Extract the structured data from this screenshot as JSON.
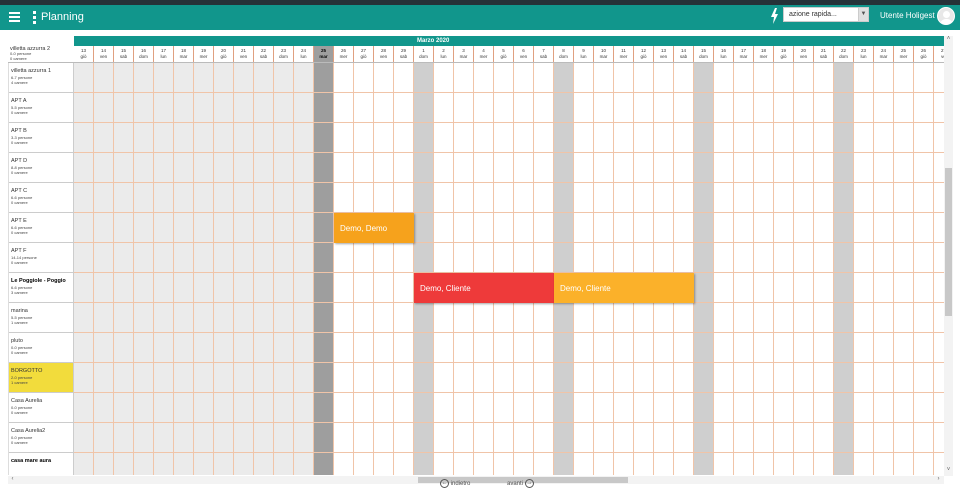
{
  "app": {
    "title": "Planning"
  },
  "header": {
    "quick_action_placeholder": "azione rapida...",
    "user_name": "Utente Holigest"
  },
  "calendar": {
    "month_label": "Marzo 2020",
    "today_index": 12,
    "days": [
      {
        "num": "13",
        "dow": "giò"
      },
      {
        "num": "14",
        "dow": "ven"
      },
      {
        "num": "15",
        "dow": "sab"
      },
      {
        "num": "16",
        "dow": "dom"
      },
      {
        "num": "17",
        "dow": "lun"
      },
      {
        "num": "18",
        "dow": "mar"
      },
      {
        "num": "19",
        "dow": "mer"
      },
      {
        "num": "20",
        "dow": "giò"
      },
      {
        "num": "21",
        "dow": "ven"
      },
      {
        "num": "22",
        "dow": "sab"
      },
      {
        "num": "23",
        "dow": "dom"
      },
      {
        "num": "24",
        "dow": "lun"
      },
      {
        "num": "25",
        "dow": "mar"
      },
      {
        "num": "26",
        "dow": "mer"
      },
      {
        "num": "27",
        "dow": "giò"
      },
      {
        "num": "28",
        "dow": "ven"
      },
      {
        "num": "29",
        "dow": "sab"
      },
      {
        "num": "1",
        "dow": "dom"
      },
      {
        "num": "2",
        "dow": "lun"
      },
      {
        "num": "3",
        "dow": "mar"
      },
      {
        "num": "4",
        "dow": "mer"
      },
      {
        "num": "5",
        "dow": "giò"
      },
      {
        "num": "6",
        "dow": "ven"
      },
      {
        "num": "7",
        "dow": "sab"
      },
      {
        "num": "8",
        "dow": "dom"
      },
      {
        "num": "9",
        "dow": "lun"
      },
      {
        "num": "10",
        "dow": "mar"
      },
      {
        "num": "11",
        "dow": "mer"
      },
      {
        "num": "12",
        "dow": "giò"
      },
      {
        "num": "13",
        "dow": "ven"
      },
      {
        "num": "14",
        "dow": "sab"
      },
      {
        "num": "15",
        "dow": "dom"
      },
      {
        "num": "16",
        "dow": "lun"
      },
      {
        "num": "17",
        "dow": "mar"
      },
      {
        "num": "18",
        "dow": "mer"
      },
      {
        "num": "19",
        "dow": "giò"
      },
      {
        "num": "20",
        "dow": "ven"
      },
      {
        "num": "21",
        "dow": "sab"
      },
      {
        "num": "22",
        "dow": "dom"
      },
      {
        "num": "23",
        "dow": "lun"
      },
      {
        "num": "24",
        "dow": "mar"
      },
      {
        "num": "25",
        "dow": "mer"
      },
      {
        "num": "26",
        "dow": "giò"
      },
      {
        "num": "27",
        "dow": "ve"
      }
    ]
  },
  "resources_first": {
    "name": "villetta azzurra 2",
    "people": "0-0 persone",
    "rooms": "0 camere"
  },
  "resources": [
    {
      "name": "villetta azzurra 1",
      "people": "6-7 persone",
      "rooms": "4 camere",
      "bold": false,
      "highlight": false
    },
    {
      "name": "APT A",
      "people": "5-5 persone",
      "rooms": "0 camere",
      "bold": false,
      "highlight": false
    },
    {
      "name": "APT B",
      "people": "3-3 persone",
      "rooms": "0 camere",
      "bold": false,
      "highlight": false
    },
    {
      "name": "APT D",
      "people": "8-8 persone",
      "rooms": "0 camere",
      "bold": false,
      "highlight": false
    },
    {
      "name": "APT C",
      "people": "6-6 persone",
      "rooms": "0 camere",
      "bold": false,
      "highlight": false
    },
    {
      "name": "APT E",
      "people": "6-6 persone",
      "rooms": "0 camere",
      "bold": false,
      "highlight": false
    },
    {
      "name": "APT F",
      "people": "14-14 persone",
      "rooms": "0 camere",
      "bold": false,
      "highlight": false
    },
    {
      "name": "Le Poggiole - Poggio",
      "people": "6-6 persone",
      "rooms": "3 camere",
      "bold": true,
      "highlight": false
    },
    {
      "name": "marina",
      "people": "5-5 persone",
      "rooms": "1 camere",
      "bold": false,
      "highlight": false
    },
    {
      "name": "pluto",
      "people": "0-0 persone",
      "rooms": "0 camere",
      "bold": false,
      "highlight": false
    },
    {
      "name": "BORGOTTO",
      "people": "2-0 persone",
      "rooms": "1 camere",
      "bold": false,
      "highlight": true
    },
    {
      "name": "Casa Aurelia",
      "people": "0-0 persone",
      "rooms": "0 camere",
      "bold": false,
      "highlight": false
    },
    {
      "name": "Casa Aurelia2",
      "people": "0-0 persone",
      "rooms": "0 camere",
      "bold": false,
      "highlight": false
    },
    {
      "name": "casa mare aura",
      "people": "",
      "rooms": "",
      "bold": true,
      "highlight": false
    }
  ],
  "bookings": [
    {
      "label": "Demo, Demo",
      "row": 5,
      "start": 13,
      "days": 4,
      "color": "#f6a21c"
    },
    {
      "label": "Demo, Cliente",
      "row": 7,
      "start": 17,
      "days": 7,
      "color": "#ee3a3a"
    },
    {
      "label": "Demo, Cliente",
      "row": 7,
      "start": 24,
      "days": 7,
      "color": "#fbb12a"
    }
  ],
  "navigation": {
    "back_label": "indietro",
    "next_label": "avanti"
  },
  "colors": {
    "brand": "#11968c",
    "past_shade": "#ebebeb",
    "weekend_shade": "#cfcfcf",
    "today_shade": "#9e9e9e",
    "resource_highlight": "#f2dc3c"
  }
}
